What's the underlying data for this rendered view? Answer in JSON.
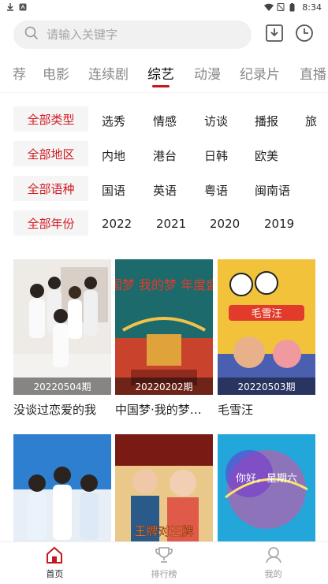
{
  "status": {
    "time": "8:34"
  },
  "search": {
    "placeholder": "请输入关键字"
  },
  "tabs": [
    {
      "label": "荐"
    },
    {
      "label": "电影"
    },
    {
      "label": "连续剧"
    },
    {
      "label": "综艺"
    },
    {
      "label": "动漫"
    },
    {
      "label": "纪录片"
    },
    {
      "label": "直播"
    }
  ],
  "filters": [
    {
      "label": "全部类型",
      "options": [
        "选秀",
        "情感",
        "访谈",
        "播报",
        "旅"
      ]
    },
    {
      "label": "全部地区",
      "options": [
        "内地",
        "港台",
        "日韩",
        "欧美"
      ]
    },
    {
      "label": "全部语种",
      "options": [
        "国语",
        "英语",
        "粤语",
        "闽南语"
      ]
    },
    {
      "label": "全部年份",
      "options": [
        "2022",
        "2021",
        "2020",
        "2019"
      ]
    }
  ],
  "cards": [
    {
      "title": "没谈过恋爱的我",
      "episode": "20220504期"
    },
    {
      "title": "中国梦·我的梦—…",
      "episode": "20220202期",
      "poster_text": "中国梦 我的梦 年度盛典"
    },
    {
      "title": "毛雪汪",
      "episode": "20220503期",
      "poster_text": "毛雪汪"
    },
    {
      "title": "",
      "episode": ""
    },
    {
      "title": "",
      "episode": "",
      "poster_text": "王牌对王牌"
    },
    {
      "title": "",
      "episode": "",
      "poster_text": "你好，星期六"
    }
  ],
  "bottom_nav": [
    {
      "label": "首页"
    },
    {
      "label": "排行榜"
    },
    {
      "label": "我的"
    }
  ],
  "colors": {
    "accent": "#c8161e"
  }
}
